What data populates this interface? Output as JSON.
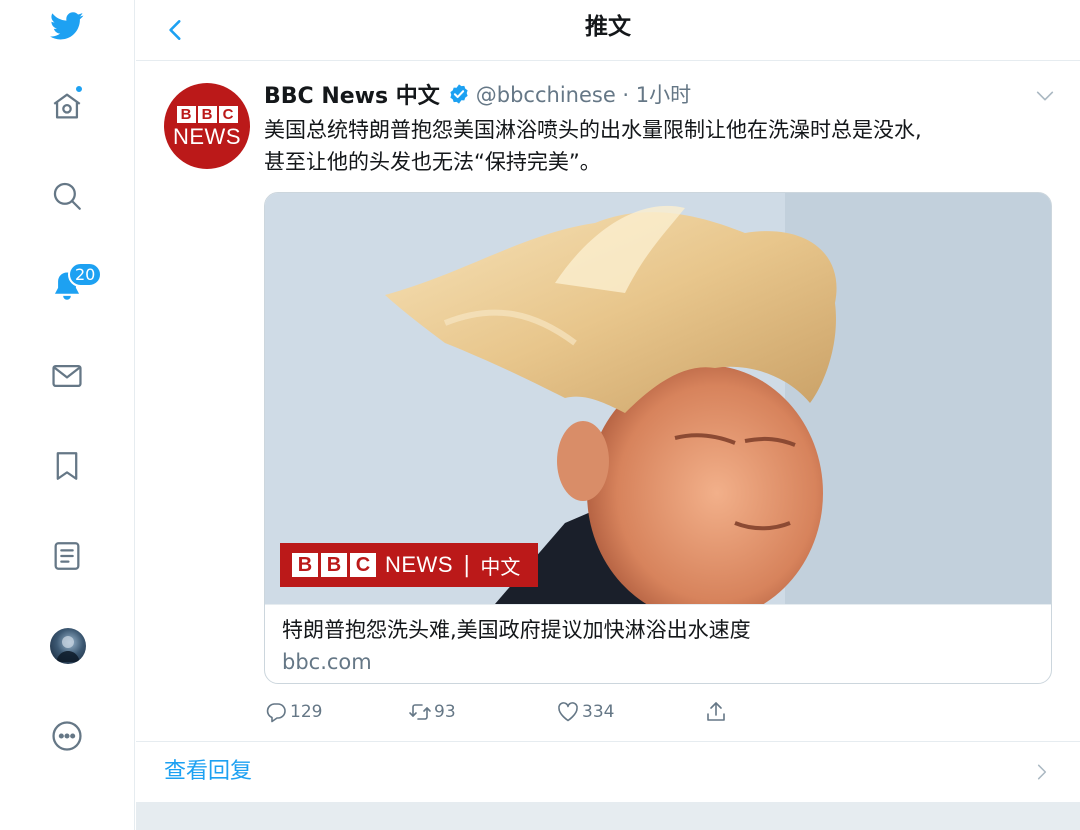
{
  "colors": {
    "accent": "#1da1f2",
    "bbc_red": "#bb1919",
    "secondary_text": "#657786"
  },
  "sidebar": {
    "items": [
      {
        "name": "twitter-logo",
        "icon": "twitter-bird-icon"
      },
      {
        "name": "home",
        "icon": "home-icon"
      },
      {
        "name": "explore",
        "icon": "search-icon"
      },
      {
        "name": "notifications",
        "icon": "bell-icon",
        "badge": "20"
      },
      {
        "name": "messages",
        "icon": "mail-icon"
      },
      {
        "name": "bookmarks",
        "icon": "bookmark-icon"
      },
      {
        "name": "lists",
        "icon": "list-icon"
      },
      {
        "name": "profile",
        "icon": "avatar"
      },
      {
        "name": "more",
        "icon": "more-icon"
      }
    ]
  },
  "header": {
    "back_icon": "chevron-left-icon",
    "title": "推文"
  },
  "tweet": {
    "author_name": "BBC News 中文",
    "verified": true,
    "handle_time": "@bbcchinese · 1小时",
    "avatar_logo": {
      "blocks": [
        "B",
        "B",
        "C"
      ],
      "word": "NEWS"
    },
    "text_line1": "美国总统特朗普抱怨美国淋浴喷头的出水量限制让他在洗澡时总是没水,",
    "text_line2": "甚至让他的头发也无法“保持完美”。",
    "card": {
      "overlay": {
        "blocks": [
          "B",
          "B",
          "C"
        ],
        "news": "NEWS",
        "separator": "|",
        "lang": "中文"
      },
      "title": "特朗普抱怨洗头难,美国政府提议加快淋浴出水速度",
      "domain": "bbc.com"
    },
    "actions": {
      "replies": "129",
      "retweets": "93",
      "likes": "334"
    }
  },
  "replies_link": "查看回复"
}
